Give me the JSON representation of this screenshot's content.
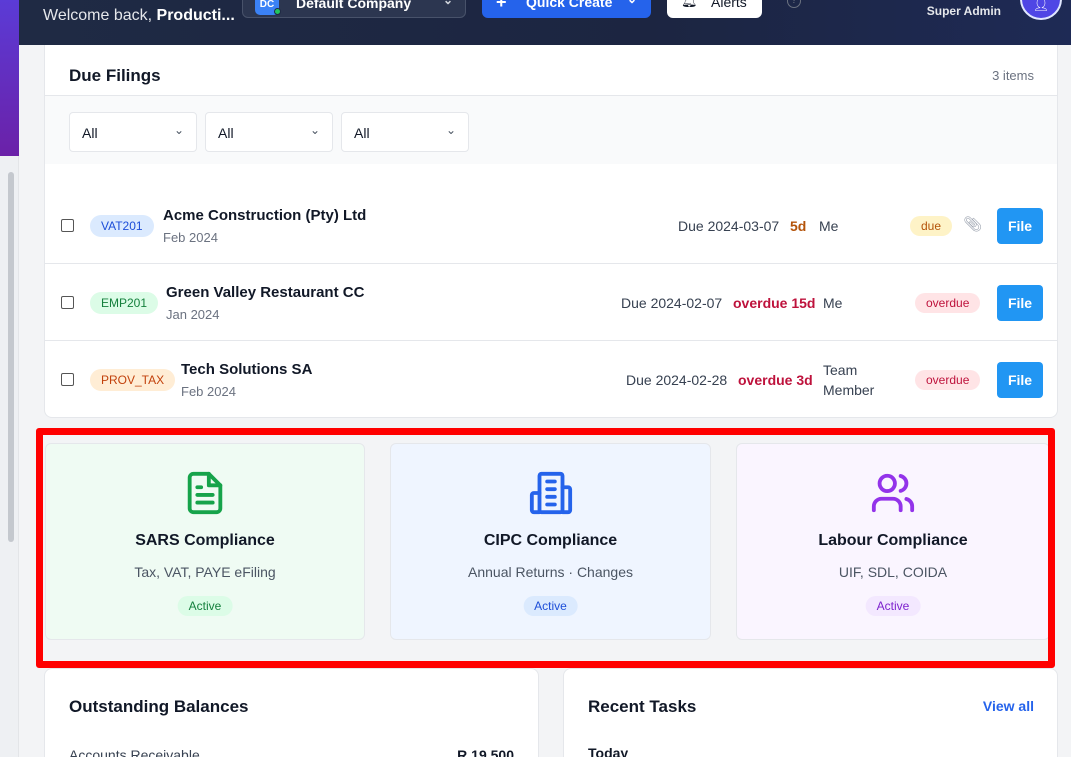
{
  "header": {
    "welcome_prefix": "Welcome back,",
    "welcome_name": "Producti...",
    "company_initials": "DC",
    "company_name": "Default Company",
    "quick_create": "Quick Create",
    "alerts": "Alerts",
    "role": "Super Admin"
  },
  "due_filings": {
    "title": "Due Filings",
    "count": "3 items",
    "filters": [
      "All",
      "All",
      "All"
    ],
    "rows": [
      {
        "tag": "VAT201",
        "name": "Acme Construction (Pty) Ltd",
        "period": "Feb 2024",
        "due": "Due 2024-03-07",
        "days": "5d",
        "assignee": "Me",
        "status": "due",
        "file": "File"
      },
      {
        "tag": "EMP201",
        "name": "Green Valley Restaurant CC",
        "period": "Jan 2024",
        "due": "Due 2024-02-07",
        "days": "overdue 15d",
        "assignee": "Me",
        "status": "overdue",
        "file": "File"
      },
      {
        "tag": "PROV_TAX",
        "name": "Tech Solutions SA",
        "period": "Feb 2024",
        "due": "Due 2024-02-28",
        "days": "overdue 3d",
        "assignee_line1": "Team",
        "assignee_line2": "Member",
        "status": "overdue",
        "file": "File"
      }
    ]
  },
  "compliance": [
    {
      "title": "SARS Compliance",
      "subtitle": "Tax, VAT, PAYE eFiling",
      "badge": "Active",
      "icon": "document-icon"
    },
    {
      "title": "CIPC Compliance",
      "subtitle": "Annual Returns · Changes",
      "badge": "Active",
      "icon": "building-icon"
    },
    {
      "title": "Labour Compliance",
      "subtitle": "UIF, SDL, COIDA",
      "badge": "Active",
      "icon": "users-icon"
    }
  ],
  "outstanding": {
    "title": "Outstanding Balances",
    "ar_label": "Accounts Receivable",
    "ar_value": "R 19 500"
  },
  "recent_tasks": {
    "title": "Recent Tasks",
    "view_all": "View all",
    "group": "Today"
  },
  "colors": {
    "sars": "#16a34a",
    "cipc": "#2563eb",
    "labour": "#9333ea",
    "file_button": "#2196f3",
    "overdue_text": "#be123c",
    "due_days": "#b45309"
  }
}
